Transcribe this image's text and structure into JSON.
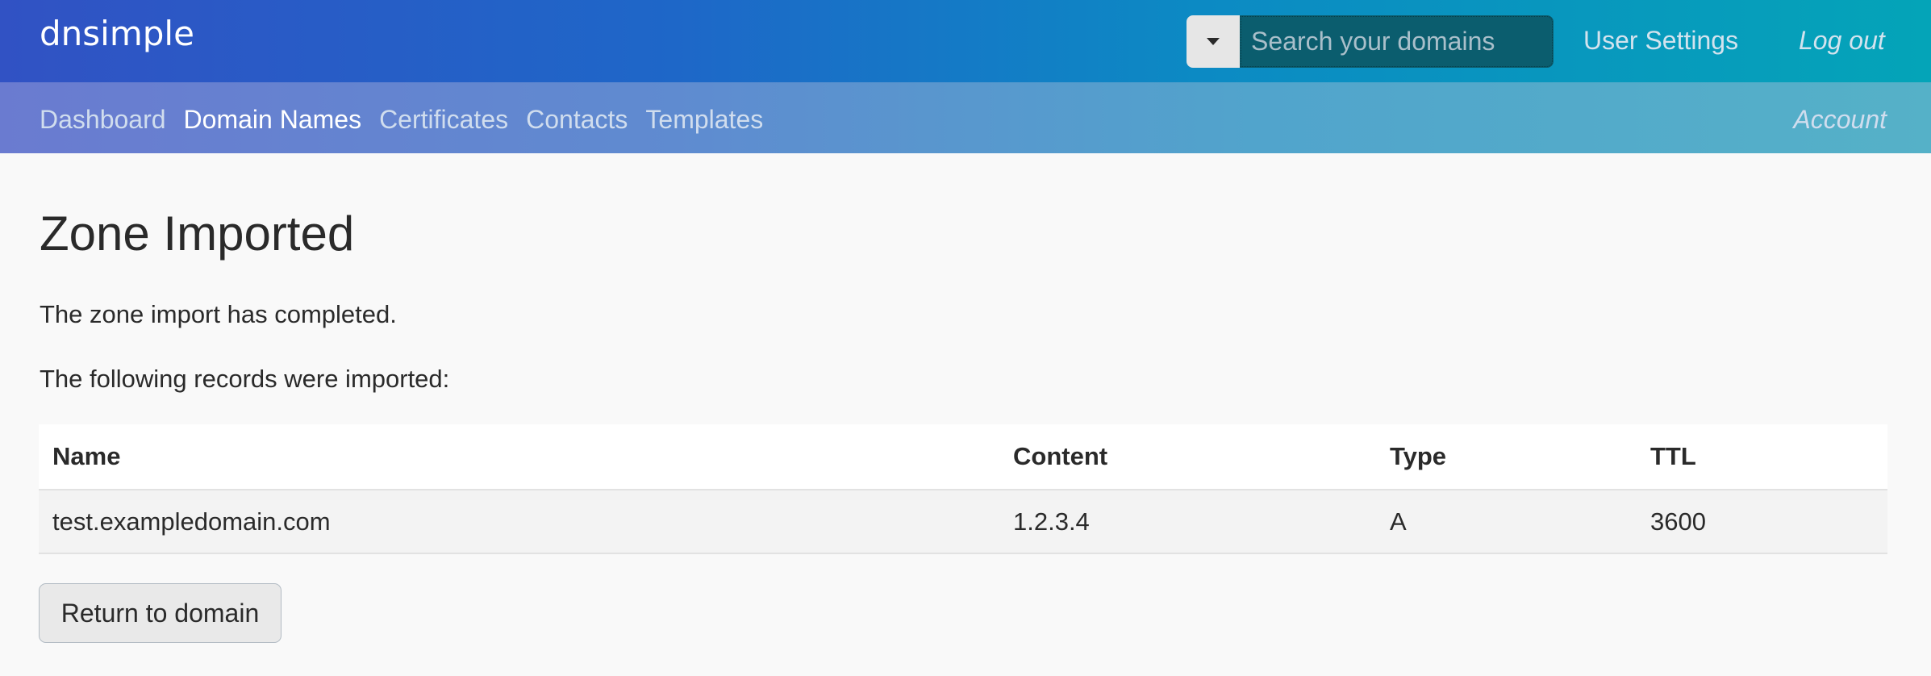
{
  "header": {
    "logo": "dnsimple",
    "search": {
      "placeholder": "Search your domains",
      "value": ""
    },
    "user_settings_label": "User Settings",
    "logout_label": "Log out"
  },
  "subnav": {
    "items": [
      {
        "label": "Dashboard",
        "active": false
      },
      {
        "label": "Domain Names",
        "active": true
      },
      {
        "label": "Certificates",
        "active": false
      },
      {
        "label": "Contacts",
        "active": false
      },
      {
        "label": "Templates",
        "active": false
      }
    ],
    "account_label": "Account"
  },
  "main": {
    "title": "Zone Imported",
    "status_text": "The zone import has completed.",
    "records_intro": "The following records were imported:",
    "table": {
      "columns": [
        "Name",
        "Content",
        "Type",
        "TTL"
      ],
      "rows": [
        {
          "name": "test.exampledomain.com",
          "content": "1.2.3.4",
          "type": "A",
          "ttl": "3600"
        }
      ]
    },
    "return_button_label": "Return to domain"
  },
  "colors": {
    "header_gradient_start": "#3152c4",
    "header_gradient_end": "#04a4b8",
    "subnav_gradient_start": "#6a7bd0",
    "subnav_gradient_end": "#55b1c8",
    "search_bg": "#0b5d6e",
    "text": "#2a2a2a"
  }
}
